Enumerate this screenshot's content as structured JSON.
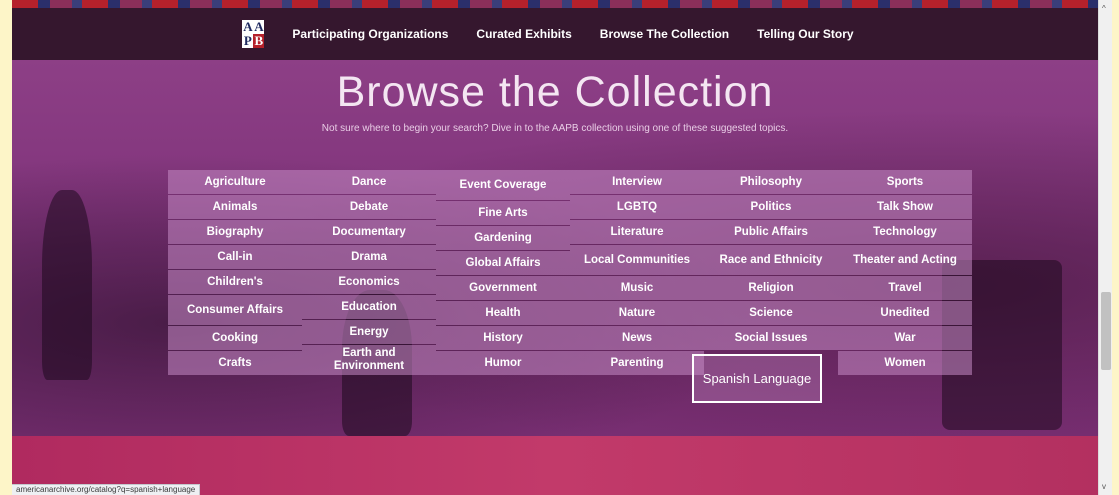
{
  "nav": {
    "logo_letters": [
      "A",
      "A",
      "P",
      "B"
    ],
    "links": [
      "Participating Organizations",
      "Curated Exhibits",
      "Browse The Collection",
      "Telling Our Story"
    ]
  },
  "hero": {
    "title": "Browse the Collection",
    "subtitle": "Not sure where to begin your search? Dive in to the AAPB collection using one of these suggested topics."
  },
  "topics": {
    "col1": [
      "Agriculture",
      "Animals",
      "Biography",
      "Call-in",
      "Children's",
      "Consumer Affairs",
      "Cooking",
      "Crafts"
    ],
    "col2": [
      "Dance",
      "Debate",
      "Documentary",
      "Drama",
      "Economics",
      "Education",
      "Energy",
      "Earth and Environment"
    ],
    "col3": [
      "Event Coverage",
      "Fine Arts",
      "Gardening",
      "Global Affairs",
      "Government",
      "Health",
      "History",
      "Humor"
    ],
    "col4": [
      "Interview",
      "LGBTQ",
      "Literature",
      "Local Communities",
      "Music",
      "Nature",
      "News",
      "Parenting"
    ],
    "col5": [
      "Philosophy",
      "Politics",
      "Public Affairs",
      "Race and Ethnicity",
      "Religion",
      "Science",
      "Social Issues",
      "Spanish Language"
    ],
    "col6": [
      "Sports",
      "Talk Show",
      "Technology",
      "Theater and Acting",
      "Travel",
      "Unedited",
      "War",
      "Women"
    ]
  },
  "selected_topic": "Spanish Language",
  "status_url": "americanarchive.org/catalog?q=spanish+language",
  "scrollbar": {
    "up": "^",
    "down": "v"
  },
  "colors": {
    "navbar": "#35172e",
    "hero": "#7e3279",
    "topic_tile": "#c48ac4",
    "lower_band": "#b02a5f"
  }
}
